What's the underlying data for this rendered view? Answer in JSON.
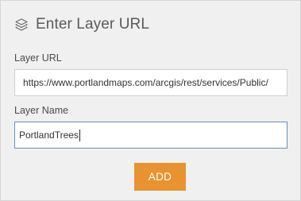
{
  "dialog": {
    "title": "Enter Layer URL",
    "title_icon": "layers-icon"
  },
  "layer_url": {
    "label": "Layer URL",
    "value": "https://www.portlandmaps.com/arcgis/rest/services/Public/"
  },
  "layer_name": {
    "label": "Layer Name",
    "value": "PortlandTrees"
  },
  "actions": {
    "add_label": "ADD"
  },
  "colors": {
    "panel_background": "#f0f0f0",
    "add_button": "#e8932f",
    "focused_border": "#6a8fb5"
  }
}
